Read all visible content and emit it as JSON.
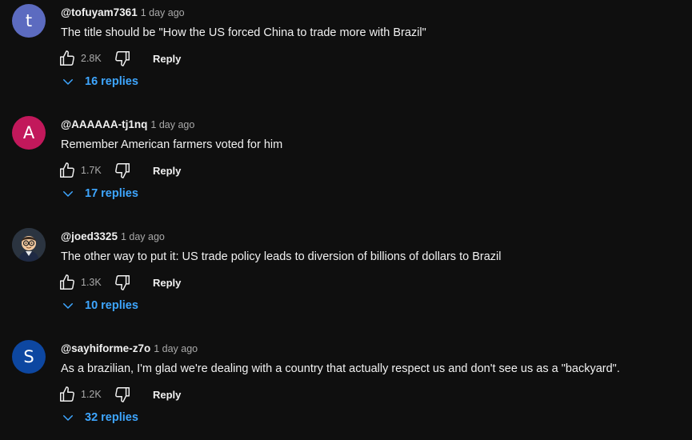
{
  "reply_label": "Reply",
  "colors": {
    "background": "#0f0f0f",
    "text": "#f1f1f1",
    "secondary": "#aaaaaa",
    "link": "#3ea6ff"
  },
  "comments": [
    {
      "avatar_letter": "t",
      "avatar_color": "#5c6bc0",
      "author": "@tofuyam7361",
      "time": "1 day ago",
      "text": "The title should be \"How the US forced China to trade more with Brazil\"",
      "likes": "2.8K",
      "replies": "16 replies"
    },
    {
      "avatar_letter": "A",
      "avatar_color": "#c2185b",
      "author": "@AAAAAA-tj1nq",
      "time": "1 day ago",
      "text": "Remember American farmers voted for him",
      "likes": "1.7K",
      "replies": "17 replies"
    },
    {
      "avatar_letter": "",
      "avatar_image": "cartoon-person-with-glasses",
      "author": "@joed3325",
      "time": "1 day ago",
      "text": "The other way to put it: US trade policy leads to diversion of billions of dollars to Brazil",
      "likes": "1.3K",
      "replies": "10 replies"
    },
    {
      "avatar_letter": "S",
      "avatar_color": "#0d47a1",
      "author": "@sayhiforme-z7o",
      "time": "1 day ago",
      "text": "As a brazilian, I'm glad we're dealing with a country that actually respect us and don't see us as a \"backyard\".",
      "likes": "1.2K",
      "replies": "32 replies"
    }
  ]
}
